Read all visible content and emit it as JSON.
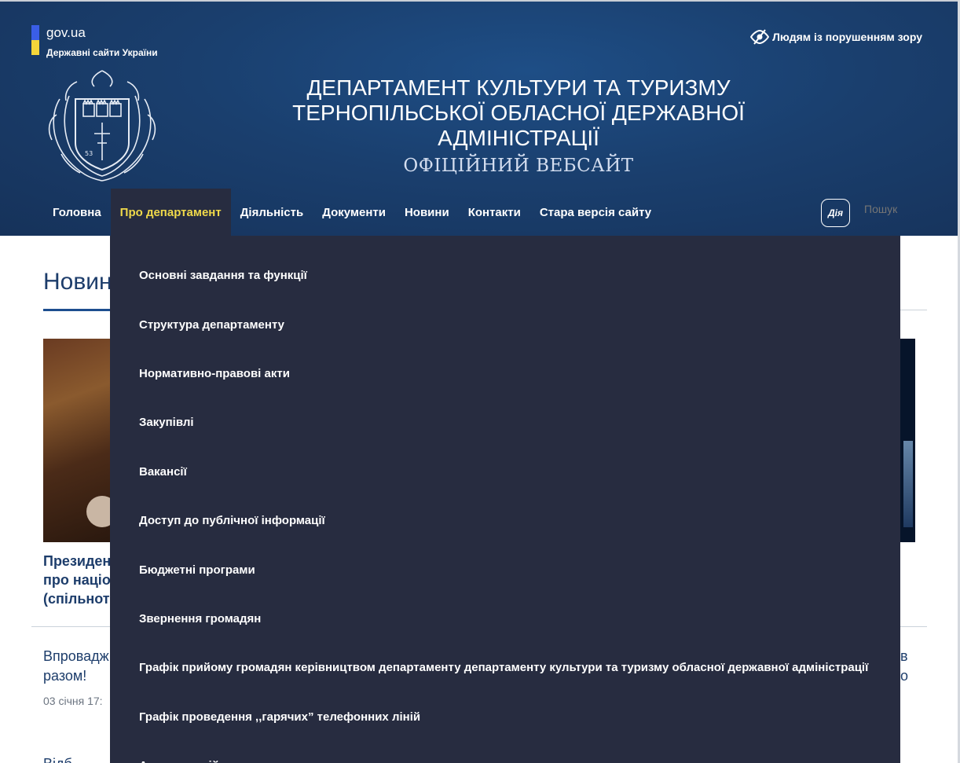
{
  "govua": {
    "name": "gov.ua",
    "subtitle": "Державні сайти України"
  },
  "accessibility": {
    "label": "Людям із порушенням зору"
  },
  "site": {
    "title": "Департамент культури та туризму Тернопільської обласної державної адміністрації",
    "subtitle": "ОФІЦІЙНИЙ ВЕБСАЙТ"
  },
  "nav": {
    "items": [
      {
        "label": "Головна"
      },
      {
        "label": "Про департамент"
      },
      {
        "label": "Діяльність"
      },
      {
        "label": "Документи"
      },
      {
        "label": "Новини"
      },
      {
        "label": "Контакти"
      },
      {
        "label": "Стара версія сайту"
      }
    ],
    "active_index": 1
  },
  "diia": {
    "label": "Дія"
  },
  "search": {
    "placeholder": "Пошук"
  },
  "dropdown": {
    "items": [
      {
        "label": "Основні завдання та функції"
      },
      {
        "label": "Структура департаменту"
      },
      {
        "label": "Нормативно-правові акти"
      },
      {
        "label": "Закупівлі"
      },
      {
        "label": "Вакансії"
      },
      {
        "label": "Доступ до публічної інформації"
      },
      {
        "label": "Бюджетні програми"
      },
      {
        "label": "Звернення громадян"
      },
      {
        "label": "Графік прийому громадян керівництвом департаменту департаменту культури та туризму обласної державної адміністрації"
      },
      {
        "label": "Графік проведення ,,гарячих” телефонних ліній"
      },
      {
        "label": "Антикорупційна..."
      }
    ]
  },
  "content": {
    "news_heading": "Новини",
    "headline_lines": [
      "Президент",
      "про націо",
      "(спільнот"
    ],
    "text_lines": [
      "Впровадж",
      "разом!"
    ],
    "date": "03 січня 17:",
    "right_text_lines": [
      "в",
      "о"
    ],
    "bottom": "Відб"
  },
  "colors": {
    "header_bg": "#1a3f6e",
    "nav_active_bg": "#272c40",
    "nav_active_text": "#f0d94a",
    "dropdown_bg": "#272c40",
    "gov_blue": "#3a5ee6",
    "gov_yellow": "#f5d63a"
  }
}
